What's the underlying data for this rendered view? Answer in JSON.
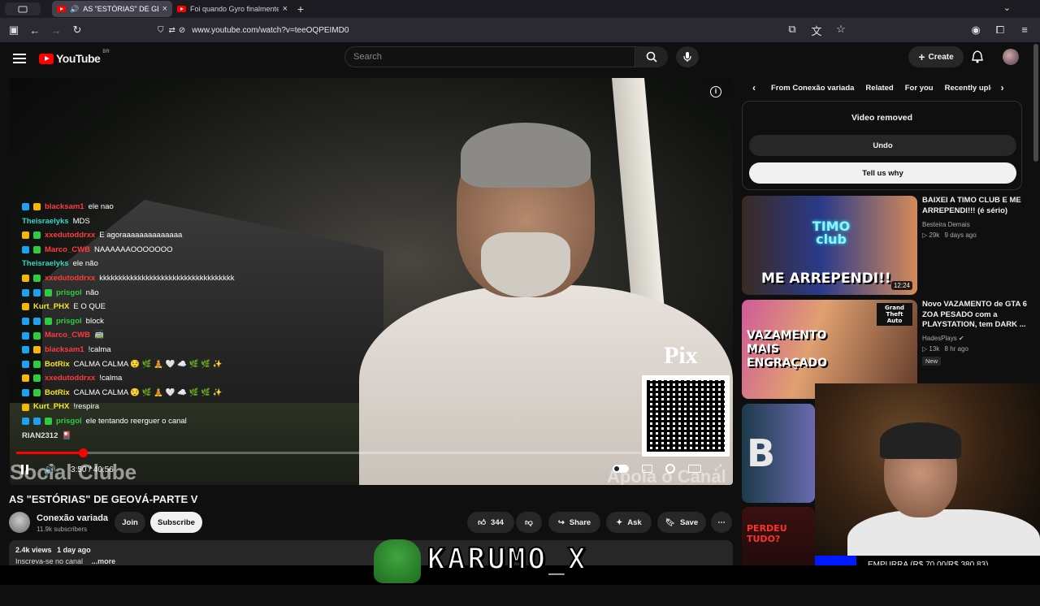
{
  "browser": {
    "tabs": [
      {
        "label": "AS \"ESTÓRIAS\" DE GEOVÁ-PARTE V",
        "active": true
      },
      {
        "label": "Foi quando Gyro finalmente entendeu",
        "active": false
      }
    ],
    "url": "www.youtube.com/watch?v=teeOQPEIMD0"
  },
  "header": {
    "logo_text": "YouTube",
    "logo_country": "BR",
    "search_placeholder": "Search",
    "create_label": "Create"
  },
  "player": {
    "current_time": "3:50",
    "duration": "40:56",
    "time_separator": "/",
    "progress_fraction": 0.094,
    "pix_label": "Pix",
    "watermark_left": "Social Clube",
    "watermark_right": "Apoia o Canal",
    "chat": [
      {
        "user": "blacksam1",
        "color": "red",
        "badges": [
          "b1",
          "b2"
        ],
        "msg": "ele nao"
      },
      {
        "user": "Theisraelyks",
        "color": "teal",
        "badges": [],
        "msg": "MDS"
      },
      {
        "user": "xxedutoddrxx",
        "color": "red",
        "badges": [
          "b2",
          "b3"
        ],
        "msg": "E agoraaaaaaaaaaaaaa"
      },
      {
        "user": "Marco_CWB",
        "color": "red",
        "badges": [
          "b1",
          "b3"
        ],
        "msg": "NAAAAAAOOOOOOO"
      },
      {
        "user": "Theisraelyks",
        "color": "teal",
        "badges": [],
        "msg": "ele não"
      },
      {
        "user": "xxedutoddrxx",
        "color": "red",
        "badges": [
          "b2",
          "b3"
        ],
        "msg": "kkkkkkkkkkkkkkkkkkkkkkkkkkkkkkkkkkk"
      },
      {
        "user": "prisgol",
        "color": "green",
        "badges": [
          "b1",
          "b1",
          "b3"
        ],
        "msg": "não"
      },
      {
        "user": "Kurt_PHX",
        "color": "yellow",
        "badges": [
          "b2"
        ],
        "msg": "E O QUE"
      },
      {
        "user": "prisgol",
        "color": "green",
        "badges": [
          "b1",
          "b1",
          "b3"
        ],
        "msg": "block"
      },
      {
        "user": "Marco_CWB",
        "color": "red",
        "badges": [
          "b1",
          "b3"
        ],
        "msg": "🚎"
      },
      {
        "user": "blacksam1",
        "color": "red",
        "badges": [
          "b1",
          "b2"
        ],
        "msg": "!calma"
      },
      {
        "user": "BotRix",
        "color": "yellow",
        "badges": [
          "b1",
          "b3"
        ],
        "msg": "CALMA CALMA 😌 🌿 🧘 🤍 ☁️ 🌿 🌿 ✨"
      },
      {
        "user": "xxedutoddrxx",
        "color": "red",
        "badges": [
          "b2",
          "b3"
        ],
        "msg": "!calma"
      },
      {
        "user": "BotRix",
        "color": "yellow",
        "badges": [
          "b1",
          "b3"
        ],
        "msg": "CALMA CALMA 😌 🌿 🧘 🤍 ☁️ 🌿 🌿 ✨"
      },
      {
        "user": "Kurt_PHX",
        "color": "yellow",
        "badges": [
          "b2"
        ],
        "msg": "!respira"
      },
      {
        "user": "prisgol",
        "color": "green",
        "badges": [
          "b1",
          "b1",
          "b3"
        ],
        "msg": "ele tentando reerguer o canal"
      },
      {
        "user": "RIAN2312",
        "color": "white",
        "badges": [],
        "msg": "🎴"
      }
    ]
  },
  "video": {
    "title": "AS \"ESTÓRIAS\" DE GEOVÁ-PARTE V",
    "channel": "Conexão variada",
    "subscribers": "11.9k subscribers",
    "join_label": "Join",
    "subscribe_label": "Subscribe",
    "likes": "344",
    "share_label": "Share",
    "ask_label": "Ask",
    "save_label": "Save",
    "views": "2.4k views",
    "age": "1 day ago",
    "desc_line": "Inscreva-se no canal",
    "more_label": "...more"
  },
  "sidebar": {
    "chips": [
      "From Conexão variada",
      "Related",
      "For you",
      "Recently uploaded"
    ],
    "removed": {
      "title": "Video removed",
      "undo_label": "Undo",
      "tell_label": "Tell us why"
    },
    "recs": [
      {
        "title": "BAIXEI A TIMO CLUB E ME ARREPENDI!!! (é sério)",
        "channel": "Besteira Demais",
        "views": "29k",
        "age": "9 days ago",
        "duration": "12:24",
        "thumb_text": "ME ARREPENDI!!",
        "thumb_logo": "TIMO club"
      },
      {
        "title": "Novo VAZAMENTO de GTA 6 ZOA PESADO com a PLAYSTATION, tem DARK ...",
        "channel": "HadesPlays",
        "views": "13k",
        "age": "8 hr ago",
        "badge": "New",
        "thumb_text": "VAZAMENTO MAIS ENGRAÇADO",
        "thumb_logo": "Grand Theft Auto"
      },
      {
        "thumb_text": "B"
      },
      {
        "thumb_text": "PERDEU TUDO?"
      }
    ]
  },
  "stream_overlay": {
    "donation": "EMPURRA (R$ 70,00/R$ 380,83)",
    "donation_progress": 0.184,
    "brand": "KARUMO_X"
  }
}
